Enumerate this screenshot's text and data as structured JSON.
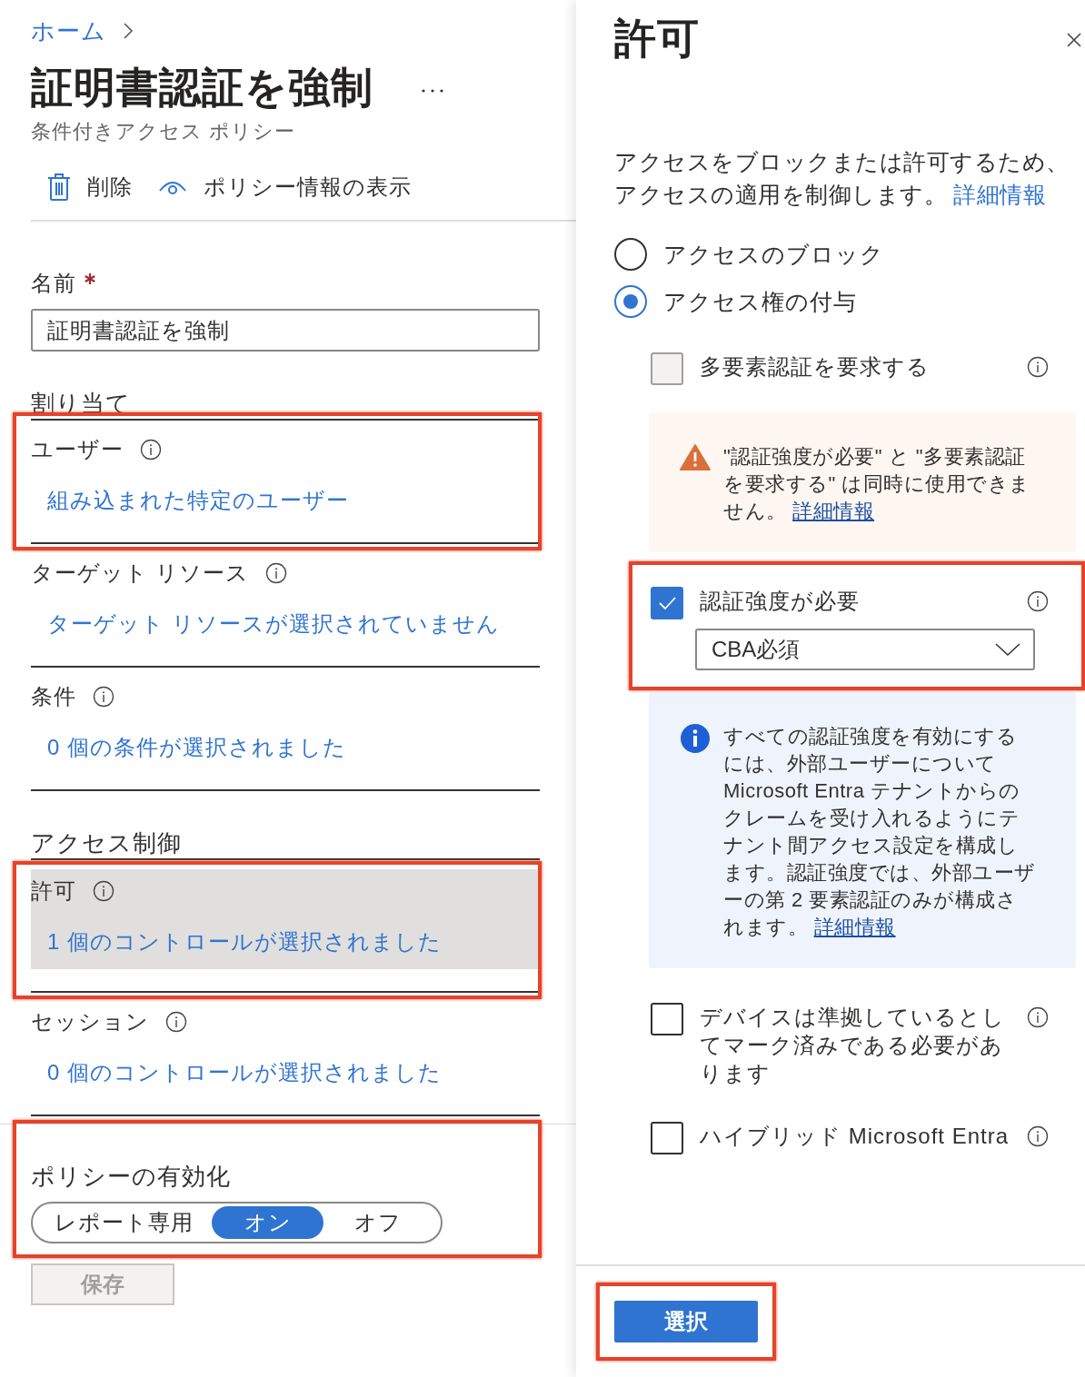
{
  "breadcrumb": [
    {
      "label": "ホーム"
    }
  ],
  "page": {
    "title": "証明書認証を強制",
    "subtitle": "条件付きアクセス ポリシー"
  },
  "toolbar": [
    {
      "kind": "trash",
      "label": "削除"
    },
    {
      "kind": "eye",
      "label": "ポリシー情報の表示"
    }
  ],
  "name_field": {
    "label": "名前",
    "required": true,
    "value": "証明書認証を強制"
  },
  "sections": [
    {
      "heading": "割り当て",
      "items": [
        {
          "label": "ユーザー",
          "info": true,
          "link": "組み込まれた特定のユーザー",
          "selected": false,
          "highlighted": true
        },
        {
          "label": "ターゲット リソース",
          "info": true,
          "link": "ターゲット リソースが選択されていません",
          "selected": false,
          "highlighted": false
        },
        {
          "label": "条件",
          "info": true,
          "link": "0 個の条件が選択されました",
          "selected": false,
          "highlighted": false
        }
      ]
    },
    {
      "heading": "アクセス制御",
      "items": [
        {
          "label": "許可",
          "info": true,
          "link": "1 個のコントロールが選択されました",
          "selected": true,
          "highlighted": true
        },
        {
          "label": "セッション",
          "info": true,
          "link": "0 個のコントロールが選択されました",
          "selected": false,
          "highlighted": false
        }
      ]
    }
  ],
  "enable_policy": {
    "label": "ポリシーの有効化",
    "highlighted": true,
    "options": [
      {
        "label": "レポート専用",
        "selected": false
      },
      {
        "label": "オン",
        "selected": true
      },
      {
        "label": "オフ",
        "selected": false
      }
    ]
  },
  "save_button": {
    "label": "保存",
    "disabled": true
  },
  "panel": {
    "title": "許可",
    "description": "アクセスをブロックまたは許可するため、アクセスの適用を制御します。",
    "description_link": "詳細情報",
    "access_options": [
      {
        "label": "アクセスのブロック",
        "selected": false
      },
      {
        "label": "アクセス権の付与",
        "selected": true
      }
    ],
    "controls": [
      {
        "kind": "checkbox",
        "label": "多要素認証を要求する",
        "checked": false,
        "disabled": true,
        "info": true,
        "highlighted": false
      },
      {
        "kind": "warning",
        "text": "\"認証強度が必要\" と \"多要素認証を要求する\" は同時に使用できません。",
        "link": "詳細情報"
      },
      {
        "kind": "checkbox",
        "label": "認証強度が必要",
        "checked": true,
        "disabled": false,
        "info": true,
        "dropdown": "CBA必須",
        "highlighted": true
      },
      {
        "kind": "info",
        "text": "すべての認証強度を有効にするには、外部ユーザーについて Microsoft Entra テナントからのクレームを受け入れるようにテナント間アクセス設定を構成します。認証強度では、外部ユーザーの第 2 要素認証のみが構成されます。",
        "link": "詳細情報"
      },
      {
        "kind": "checkbox",
        "label": "デバイスは準拠しているとしてマーク済みである必要があります",
        "checked": false,
        "disabled": false,
        "info": true,
        "highlighted": false
      },
      {
        "kind": "checkbox",
        "label": "ハイブリッド Microsoft Entra",
        "checked": false,
        "disabled": false,
        "info": true,
        "highlighted": false
      }
    ],
    "select_button": {
      "label": "選択",
      "highlighted": true
    }
  }
}
